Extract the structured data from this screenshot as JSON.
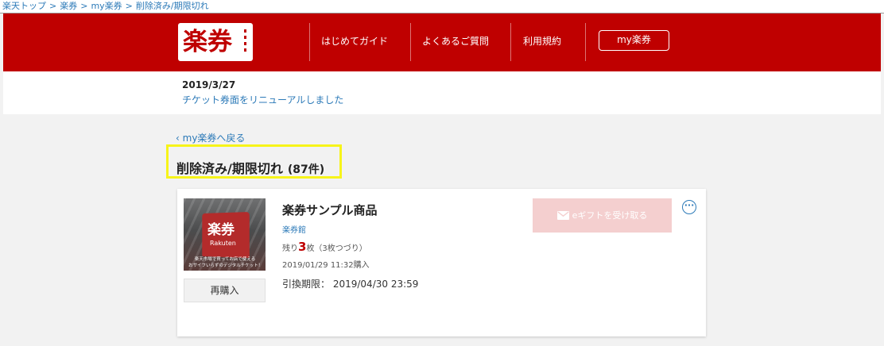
{
  "breadcrumb": {
    "items": [
      "楽天トップ",
      "楽券",
      "my楽券",
      "削除済み/期限切れ"
    ],
    "separator": ">"
  },
  "header": {
    "logo_text": "楽券",
    "nav": [
      "はじめてガイド",
      "よくあるご質問",
      "利用規約"
    ],
    "my_button": "my楽券"
  },
  "notice": {
    "date": "2019/3/27",
    "text": "チケット券面をリニューアルしました"
  },
  "back_link": "my楽券へ戻る",
  "page_title": {
    "main": "削除済み/期限切れ",
    "count": "(87件)"
  },
  "item": {
    "name": "楽券サンプル商品",
    "shop": "楽券館",
    "remaining_prefix": "残り",
    "remaining_num": "3",
    "remaining_suffix": "枚（3枚つづり）",
    "purchased": "2019/01/29 11:32購入",
    "expiry_label": "引換期限：",
    "expiry_value": "2019/04/30 23:59",
    "rebuy_button": "再購入",
    "egift_button": "eギフトを受け取る",
    "more_icon": "ellipsis-circle-icon",
    "thumbnail": {
      "logo": "楽券",
      "sub": "Rakuten",
      "caption1": "楽天市場で買ってお店で使える",
      "caption2": "おサイフいらずのデジタルチケット！"
    }
  },
  "colors": {
    "brand_red": "#bf0000",
    "link_blue": "#2c7ab8",
    "highlight_yellow": "#f7f41a",
    "egift_disabled": "#f4cfcf"
  }
}
